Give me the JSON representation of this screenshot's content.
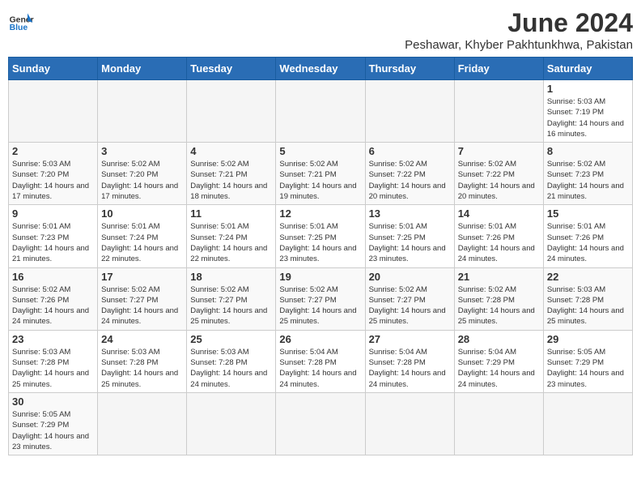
{
  "header": {
    "logo_general": "General",
    "logo_blue": "Blue",
    "title": "June 2024",
    "subtitle": "Peshawar, Khyber Pakhtunkhwa, Pakistan"
  },
  "days_of_week": [
    "Sunday",
    "Monday",
    "Tuesday",
    "Wednesday",
    "Thursday",
    "Friday",
    "Saturday"
  ],
  "weeks": [
    [
      {
        "day": "",
        "info": ""
      },
      {
        "day": "",
        "info": ""
      },
      {
        "day": "",
        "info": ""
      },
      {
        "day": "",
        "info": ""
      },
      {
        "day": "",
        "info": ""
      },
      {
        "day": "",
        "info": ""
      },
      {
        "day": "1",
        "info": "Sunrise: 5:03 AM\nSunset: 7:19 PM\nDaylight: 14 hours and 16 minutes."
      }
    ],
    [
      {
        "day": "2",
        "info": "Sunrise: 5:03 AM\nSunset: 7:20 PM\nDaylight: 14 hours and 17 minutes."
      },
      {
        "day": "3",
        "info": "Sunrise: 5:02 AM\nSunset: 7:20 PM\nDaylight: 14 hours and 17 minutes."
      },
      {
        "day": "4",
        "info": "Sunrise: 5:02 AM\nSunset: 7:21 PM\nDaylight: 14 hours and 18 minutes."
      },
      {
        "day": "5",
        "info": "Sunrise: 5:02 AM\nSunset: 7:21 PM\nDaylight: 14 hours and 19 minutes."
      },
      {
        "day": "6",
        "info": "Sunrise: 5:02 AM\nSunset: 7:22 PM\nDaylight: 14 hours and 20 minutes."
      },
      {
        "day": "7",
        "info": "Sunrise: 5:02 AM\nSunset: 7:22 PM\nDaylight: 14 hours and 20 minutes."
      },
      {
        "day": "8",
        "info": "Sunrise: 5:02 AM\nSunset: 7:23 PM\nDaylight: 14 hours and 21 minutes."
      }
    ],
    [
      {
        "day": "9",
        "info": "Sunrise: 5:01 AM\nSunset: 7:23 PM\nDaylight: 14 hours and 21 minutes."
      },
      {
        "day": "10",
        "info": "Sunrise: 5:01 AM\nSunset: 7:24 PM\nDaylight: 14 hours and 22 minutes."
      },
      {
        "day": "11",
        "info": "Sunrise: 5:01 AM\nSunset: 7:24 PM\nDaylight: 14 hours and 22 minutes."
      },
      {
        "day": "12",
        "info": "Sunrise: 5:01 AM\nSunset: 7:25 PM\nDaylight: 14 hours and 23 minutes."
      },
      {
        "day": "13",
        "info": "Sunrise: 5:01 AM\nSunset: 7:25 PM\nDaylight: 14 hours and 23 minutes."
      },
      {
        "day": "14",
        "info": "Sunrise: 5:01 AM\nSunset: 7:26 PM\nDaylight: 14 hours and 24 minutes."
      },
      {
        "day": "15",
        "info": "Sunrise: 5:01 AM\nSunset: 7:26 PM\nDaylight: 14 hours and 24 minutes."
      }
    ],
    [
      {
        "day": "16",
        "info": "Sunrise: 5:02 AM\nSunset: 7:26 PM\nDaylight: 14 hours and 24 minutes."
      },
      {
        "day": "17",
        "info": "Sunrise: 5:02 AM\nSunset: 7:27 PM\nDaylight: 14 hours and 24 minutes."
      },
      {
        "day": "18",
        "info": "Sunrise: 5:02 AM\nSunset: 7:27 PM\nDaylight: 14 hours and 25 minutes."
      },
      {
        "day": "19",
        "info": "Sunrise: 5:02 AM\nSunset: 7:27 PM\nDaylight: 14 hours and 25 minutes."
      },
      {
        "day": "20",
        "info": "Sunrise: 5:02 AM\nSunset: 7:27 PM\nDaylight: 14 hours and 25 minutes."
      },
      {
        "day": "21",
        "info": "Sunrise: 5:02 AM\nSunset: 7:28 PM\nDaylight: 14 hours and 25 minutes."
      },
      {
        "day": "22",
        "info": "Sunrise: 5:03 AM\nSunset: 7:28 PM\nDaylight: 14 hours and 25 minutes."
      }
    ],
    [
      {
        "day": "23",
        "info": "Sunrise: 5:03 AM\nSunset: 7:28 PM\nDaylight: 14 hours and 25 minutes."
      },
      {
        "day": "24",
        "info": "Sunrise: 5:03 AM\nSunset: 7:28 PM\nDaylight: 14 hours and 25 minutes."
      },
      {
        "day": "25",
        "info": "Sunrise: 5:03 AM\nSunset: 7:28 PM\nDaylight: 14 hours and 24 minutes."
      },
      {
        "day": "26",
        "info": "Sunrise: 5:04 AM\nSunset: 7:28 PM\nDaylight: 14 hours and 24 minutes."
      },
      {
        "day": "27",
        "info": "Sunrise: 5:04 AM\nSunset: 7:28 PM\nDaylight: 14 hours and 24 minutes."
      },
      {
        "day": "28",
        "info": "Sunrise: 5:04 AM\nSunset: 7:29 PM\nDaylight: 14 hours and 24 minutes."
      },
      {
        "day": "29",
        "info": "Sunrise: 5:05 AM\nSunset: 7:29 PM\nDaylight: 14 hours and 23 minutes."
      }
    ],
    [
      {
        "day": "30",
        "info": "Sunrise: 5:05 AM\nSunset: 7:29 PM\nDaylight: 14 hours and 23 minutes."
      },
      {
        "day": "",
        "info": ""
      },
      {
        "day": "",
        "info": ""
      },
      {
        "day": "",
        "info": ""
      },
      {
        "day": "",
        "info": ""
      },
      {
        "day": "",
        "info": ""
      },
      {
        "day": "",
        "info": ""
      }
    ]
  ]
}
